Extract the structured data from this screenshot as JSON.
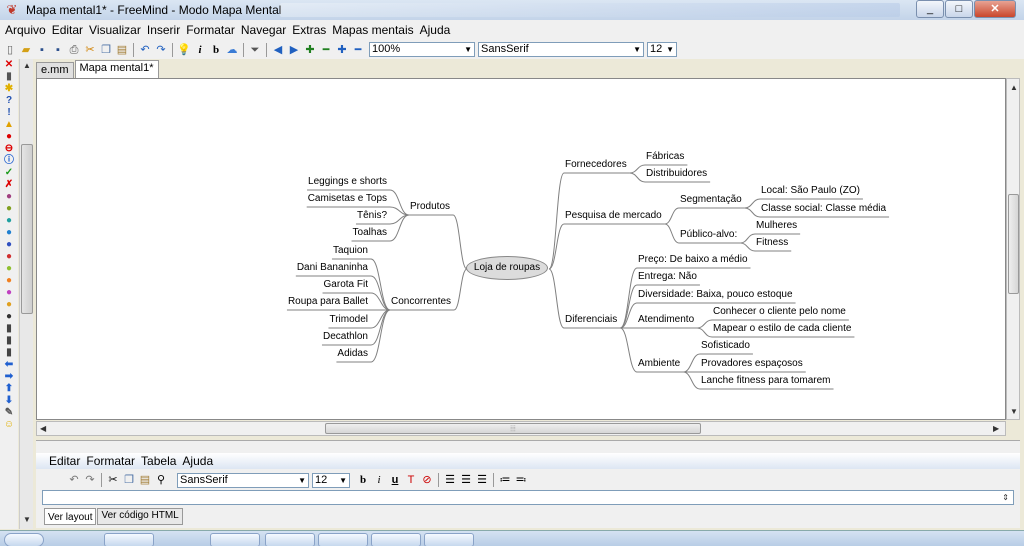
{
  "window": {
    "title": "Mapa mental1* - FreeMind - Modo Mapa Mental",
    "min_glyph": "_",
    "max_glyph": "□",
    "close_glyph": "✕"
  },
  "menubar": [
    "Arquivo",
    "Editar",
    "Visualizar",
    "Inserir",
    "Formatar",
    "Navegar",
    "Extras",
    "Mapas mentais",
    "Ajuda"
  ],
  "toolbar": {
    "zoom": "100%",
    "font": "SansSerif",
    "size": "12",
    "icons": [
      "new-icon",
      "open-icon",
      "save-icon",
      "save-as-icon",
      "print-icon",
      "cut-icon",
      "copy-icon",
      "paste-icon",
      "undo-icon",
      "redo-icon",
      "idea-icon",
      "italic-icon",
      "bold-icon",
      "cloud-icon",
      "filter-icon",
      "back-icon",
      "forward-icon",
      "expand-icon",
      "collapse-icon",
      "expand-all-icon",
      "collapse-all-icon"
    ]
  },
  "tabs": [
    "e.mm",
    "Mapa mental1*"
  ],
  "mindmap": {
    "root": "Loja de roupas",
    "nodes": {
      "fornecedores": "Fornecedores",
      "fabricas": "Fábricas",
      "distribuidores": "Distribuidores",
      "pesquisa": "Pesquisa de mercado",
      "segmentacao": "Segmentação",
      "local": "Local: São Paulo (ZO)",
      "classe": "Classe social: Classe média",
      "publico": "Público-alvo:",
      "mulheres": "Mulheres",
      "fitness": "Fitness",
      "diferenciais": "Diferenciais",
      "preco": "Preço: De baixo a médio",
      "entrega": "Entrega: Não",
      "diversidade": "Diversidade: Baixa, pouco estoque",
      "atendimento": "Atendimento",
      "conhecer": "Conhecer o cliente pelo nome",
      "mapear": "Mapear o estilo de cada cliente",
      "ambiente": "Ambiente",
      "sofisticado": "Sofisticado",
      "provadores": "Provadores espaçosos",
      "lanche": "Lanche fitness para tomarem",
      "produtos": "Produtos",
      "leggings": "Leggings e shorts",
      "camisetas": "Camisetas e Tops",
      "tenis": "Tênis?",
      "toalhas": "Toalhas",
      "concorrentes": "Concorrentes",
      "taquion": "Taquion",
      "dani": "Dani Bananinha",
      "garota": "Garota Fit",
      "roupa_ballet": "Roupa para Ballet",
      "trimodel": "Trimodel",
      "decathlon": "Decathlon",
      "adidas": "Adidas"
    }
  },
  "editor": {
    "menu": [
      "Editar",
      "Formatar",
      "Tabela",
      "Ajuda"
    ],
    "font": "SansSerif",
    "size": "12",
    "tabs": [
      "Ver layout",
      "Ver código HTML"
    ]
  }
}
